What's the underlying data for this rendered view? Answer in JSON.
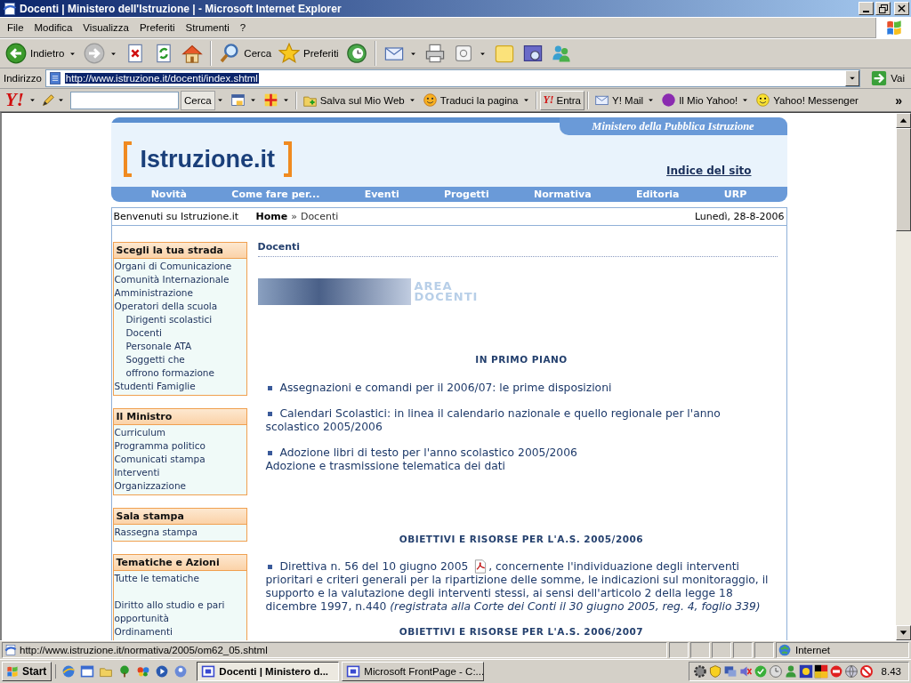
{
  "window": {
    "title": "Docenti | Ministero dell'Istruzione | - Microsoft Internet Explorer"
  },
  "menu": [
    "File",
    "Modifica",
    "Visualizza",
    "Preferiti",
    "Strumenti",
    "?"
  ],
  "toolbar": [
    {
      "kind": "back",
      "label": "Indietro",
      "dropdown": true
    },
    {
      "kind": "forward",
      "dropdown": true
    },
    {
      "kind": "stop"
    },
    {
      "kind": "refresh"
    },
    {
      "kind": "home"
    },
    {
      "kind": "separator"
    },
    {
      "kind": "search",
      "label": "Cerca"
    },
    {
      "kind": "favorites",
      "label": "Preferiti"
    },
    {
      "kind": "history"
    },
    {
      "kind": "separator"
    },
    {
      "kind": "mail",
      "dropdown": true
    },
    {
      "kind": "print"
    },
    {
      "kind": "edit",
      "dropdown": true
    },
    {
      "kind": "note"
    },
    {
      "kind": "media"
    },
    {
      "kind": "messenger"
    }
  ],
  "address": {
    "label": "Indirizzo",
    "value": "http://www.istruzione.it/docenti/index.shtml",
    "selected": true,
    "go": "Vai"
  },
  "yahoo_bar": {
    "logo": "Y!",
    "search_button": "Cerca",
    "items": [
      {
        "kind": "calendar",
        "dropdown": true
      },
      {
        "kind": "cross",
        "dropdown": true
      },
      {
        "kind": "save",
        "label": "Salva sul Mio Web",
        "dropdown": true
      },
      {
        "kind": "translate",
        "label": "Traduci la pagina",
        "dropdown": true
      },
      {
        "kind": "signin",
        "badge": "Y!",
        "label": "Entra"
      },
      {
        "kind": "mail",
        "label": "Y! Mail",
        "dropdown": true
      },
      {
        "kind": "myyahoo",
        "label": "Il Mio Yahoo!",
        "dropdown": true
      },
      {
        "kind": "smiley",
        "label": "Yahoo! Messenger"
      }
    ],
    "more": "»"
  },
  "page": {
    "tagline": "Ministero della Pubblica Istruzione",
    "logo": "Istruzione.it",
    "site_index": "Indice del sito",
    "nav": [
      "Novità",
      "Come fare per...",
      "Eventi",
      "Progetti",
      "Normativa",
      "Editoria",
      "URP"
    ],
    "breadcrumb": {
      "welcome": "Benvenuti su Istruzione.it",
      "home": "Home",
      "separator": "»",
      "current": "Docenti",
      "date": "Lunedì, 28-8-2006"
    },
    "sidebar": [
      {
        "title": "Scegli la tua strada",
        "items": [
          {
            "label": "Organi di Comunicazione"
          },
          {
            "label": "Comunità Internazionale"
          },
          {
            "label": "Amministrazione"
          },
          {
            "label": "Operatori della scuola",
            "children": [
              {
                "label": "Dirigenti scolastici"
              },
              {
                "label": "Docenti"
              },
              {
                "label": "Personale ATA"
              },
              {
                "label": "Soggetti che offrono formazione"
              }
            ]
          },
          {
            "label": "Studenti Famiglie"
          }
        ]
      },
      {
        "title": "Il Ministro",
        "items": [
          {
            "label": "Curriculum"
          },
          {
            "label": "Programma politico"
          },
          {
            "label": "Comunicati stampa"
          },
          {
            "label": "Interventi"
          },
          {
            "label": "Organizzazione"
          }
        ]
      },
      {
        "title": "Sala stampa",
        "items": [
          {
            "label": "Rassegna stampa"
          }
        ]
      },
      {
        "title": "Tematiche e Azioni",
        "items": [
          {
            "label": "Tutte le tematiche"
          }
        ],
        "more_items": [
          {
            "label": "Diritto allo studio e pari opportunità"
          },
          {
            "label": "Ordinamenti"
          }
        ]
      }
    ],
    "main": {
      "title": "Docenti",
      "banner": [
        "AREA",
        "DOCENTI"
      ],
      "sections": [
        {
          "heading": "IN PRIMO PIANO",
          "items": [
            {
              "text": "Assegnazioni e comandi per il 2006/07: le prime disposizioni"
            },
            {
              "text": "Calendari Scolastici: in linea il calendario nazionale e quello regionale per l'anno",
              "continuation": "scolastico 2005/2006"
            },
            {
              "text": "Adozione libri di testo per l'anno scolastico 2005/2006",
              "note": "Adozione e trasmissione telematica dei dati"
            }
          ]
        },
        {
          "heading": "OBIETTIVI E RISORSE PER L'A.S. 2005/2006",
          "items": [
            {
              "text": "Direttiva n. 56 del 10 giugno 2005",
              "pdf": true,
              "rest": ", concernente l'individuazione degli interventi",
              "continuation": "prioritari e criteri generali per la ripartizione delle somme, le indicazioni sul monitoraggio, il supporto e la valutazione degli interventi stessi, ai sensi dell'articolo 2 della legge 18 dicembre 1997, n.440 *(registrata alla Corte dei Conti il 30 giugno 2005, reg. 4, foglio 339)*"
            }
          ]
        },
        {
          "heading": "OBIETTIVI E RISORSE PER L'A.S. 2006/2007"
        }
      ]
    }
  },
  "status_bar": {
    "text": "http://www.istruzione.it/normativa/2005/om62_05.shtml",
    "zone": "Internet"
  },
  "taskbar": {
    "start": "Start",
    "tasks": [
      {
        "label": "Docenti | Ministero d...",
        "selected": true
      },
      {
        "label": "Microsoft FrontPage - C:...",
        "selected": false
      }
    ],
    "clock": "8.43"
  }
}
